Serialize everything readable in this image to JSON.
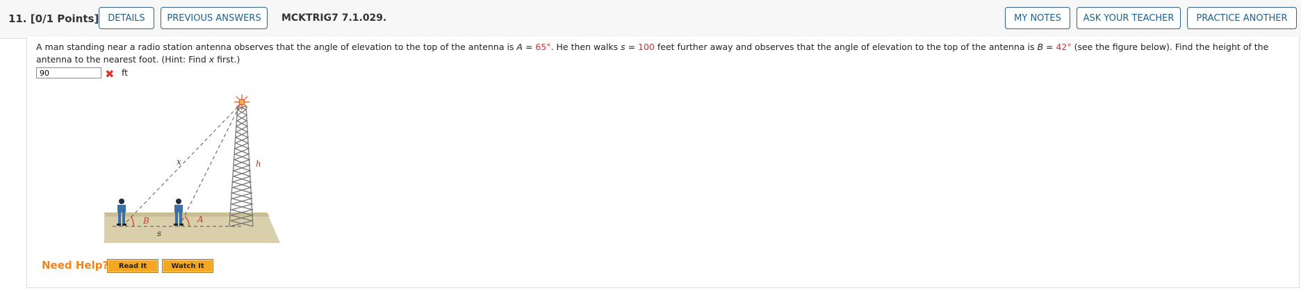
{
  "header": {
    "question_label": "11.  [0/1 Points]",
    "details_label": "DETAILS",
    "previous_answers_label": "PREVIOUS ANSWERS",
    "question_code": "MCKTRIG7 7.1.029.",
    "my_notes_label": "MY NOTES",
    "ask_teacher_label": "ASK YOUR TEACHER",
    "practice_another_label": "PRACTICE ANOTHER"
  },
  "problem": {
    "text_1": "A man standing near a radio station antenna observes that the angle of elevation to the top of the antenna is ",
    "var_A": "A",
    "eq_A": " = ",
    "val_A": "65°",
    "text_2": ". He then walks ",
    "var_s": "s",
    "eq_s": " = ",
    "val_s": "100",
    "text_3": " feet further away and observes that the angle of elevation to the top of the antenna is ",
    "var_B": "B",
    "eq_B": " = ",
    "val_B": "42°",
    "text_4": " (see the figure below). Find the height of the antenna to the nearest foot. (Hint: Find ",
    "var_x": "x",
    "text_5": " first.)"
  },
  "answer": {
    "value": "90",
    "unit": "ft",
    "status": "incorrect"
  },
  "figure": {
    "label_x": "x",
    "label_h": "h",
    "label_B": "B",
    "label_A": "A",
    "label_s": "s"
  },
  "help": {
    "label": "Need Help?",
    "read_it": "Read It",
    "watch_it": "Watch It"
  },
  "colors": {
    "accent": "#1f5f8b",
    "value_red": "#d03030",
    "help_orange": "#f0841c",
    "button_orange": "#f5a623"
  }
}
